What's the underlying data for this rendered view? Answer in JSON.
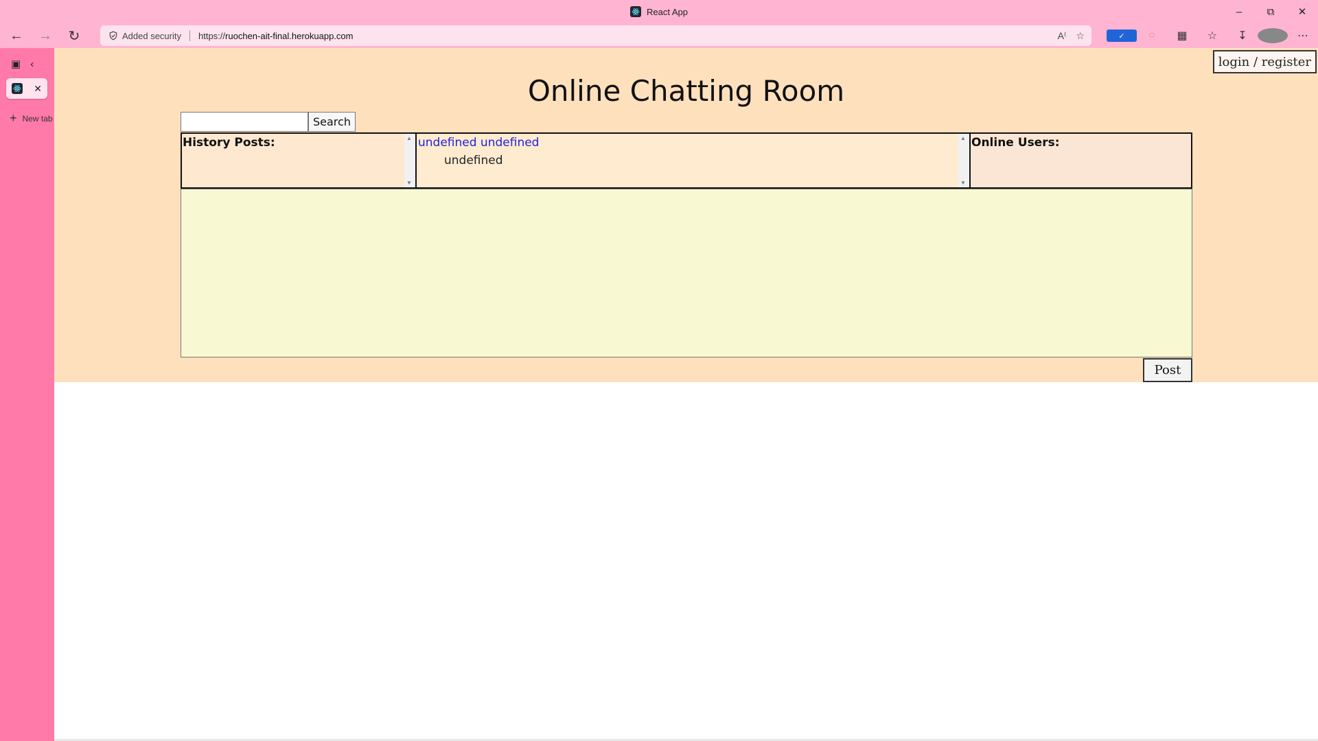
{
  "browser": {
    "window_title": "React App",
    "security_label": "Added security",
    "url_prefix": "https://",
    "url_host": "ruochen-ait-final.herokuapp.com",
    "theme_color": "#ffb5d1",
    "sidebar_color": "#ff7aa8"
  },
  "sidebar": {
    "new_tab_label": "New tab"
  },
  "page": {
    "login_label": "login / register",
    "title": "Online Chatting Room",
    "search": {
      "value": "",
      "button_label": "Search"
    },
    "history_label": "History Posts:",
    "online_label": "Online Users:",
    "messages": [
      {
        "user": "undefined undefined",
        "text": "undefined"
      }
    ],
    "post_value": "",
    "post_label": "Post",
    "background_color": "#ffe0bd"
  }
}
